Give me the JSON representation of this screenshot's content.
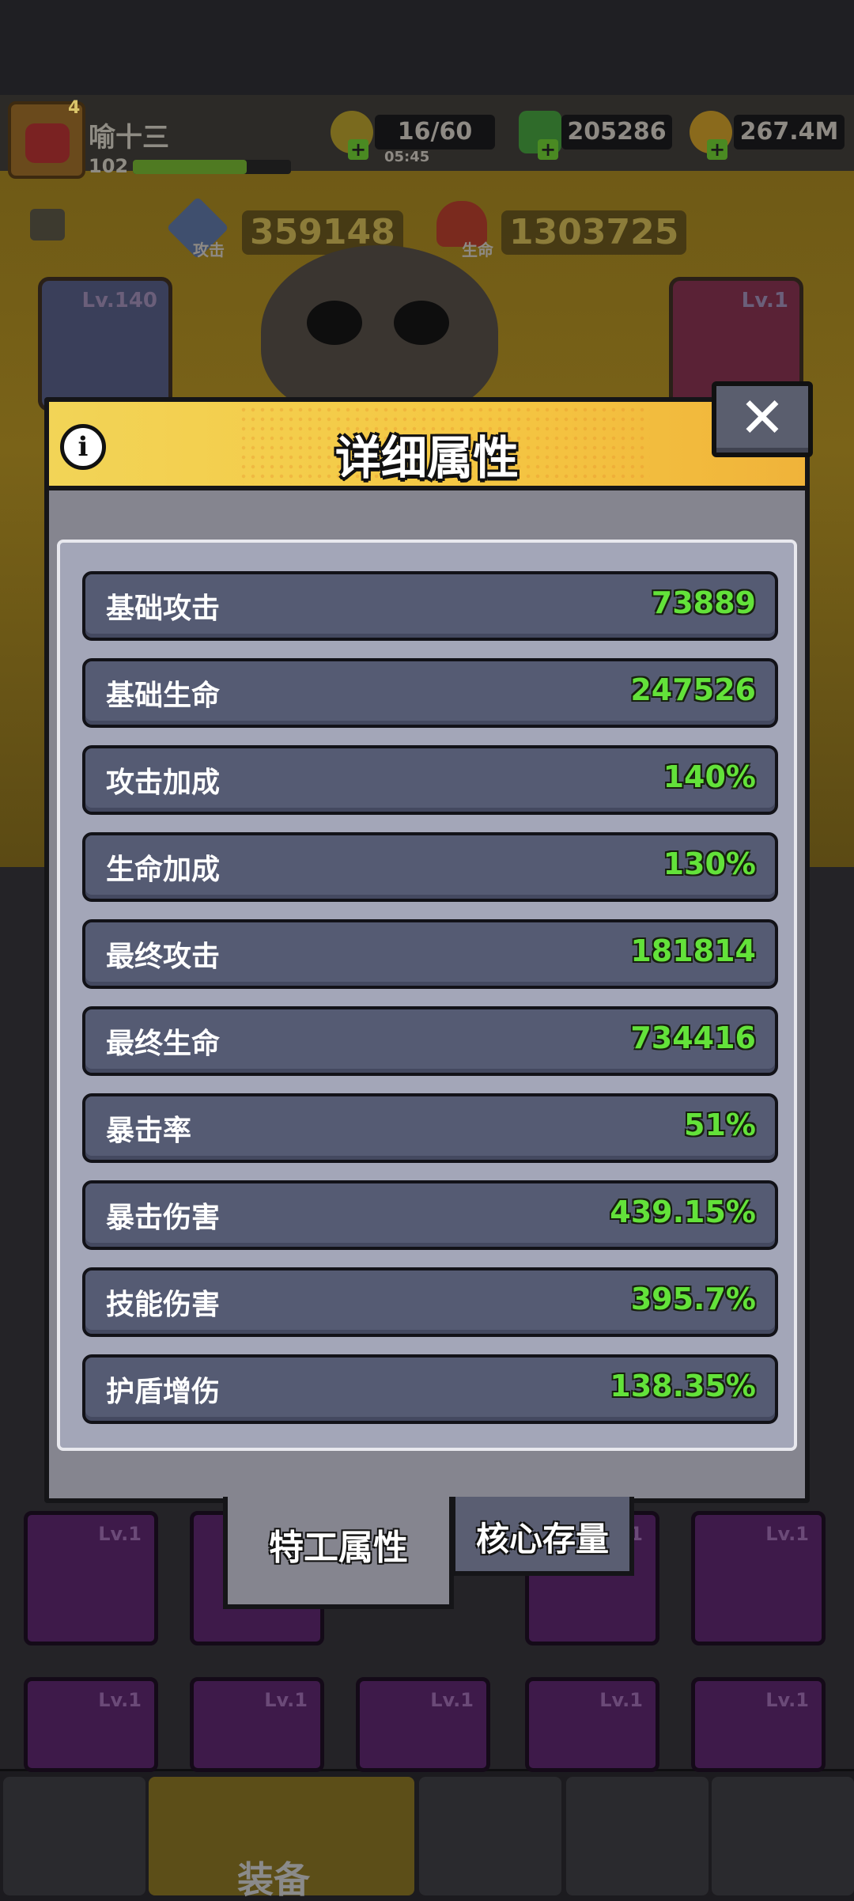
{
  "header": {
    "player_name": "喻十三",
    "player_level_badge": "4",
    "exp_level": "102",
    "exp_progress": 0.72,
    "energy": "16/60",
    "energy_timer": "05:45",
    "gems": "205286",
    "gold": "267.4M"
  },
  "hero": {
    "attack_label": "攻击",
    "attack_value": "359148",
    "hp_label": "生命",
    "hp_value": "1303725",
    "left_slot_level": "Lv.140",
    "right_slot_level": "Lv.1"
  },
  "modal": {
    "title": "详细属性",
    "info_icon": "i",
    "close_icon": "✕",
    "stats": [
      {
        "label": "基础攻击",
        "value": "73889"
      },
      {
        "label": "基础生命",
        "value": "247526"
      },
      {
        "label": "攻击加成",
        "value": "140%"
      },
      {
        "label": "生命加成",
        "value": "130%"
      },
      {
        "label": "最终攻击",
        "value": "181814"
      },
      {
        "label": "最终生命",
        "value": "734416"
      },
      {
        "label": "暴击率",
        "value": "51%"
      },
      {
        "label": "暴击伤害",
        "value": "439.15%"
      },
      {
        "label": "技能伤害",
        "value": "395.7%"
      },
      {
        "label": "护盾增伤",
        "value": "138.35%"
      }
    ],
    "tabs": [
      {
        "label": "特工属性",
        "active": true
      },
      {
        "label": "核心存量",
        "active": false
      }
    ]
  },
  "inventory": {
    "slot_level": "Lv.1"
  },
  "bottom_nav": {
    "active_label": "装备"
  },
  "colors": {
    "accent_yellow": "#f5c843",
    "stat_value_green": "#63e23a",
    "row_bg": "#555b73",
    "panel_bg": "#a3a6b8"
  }
}
